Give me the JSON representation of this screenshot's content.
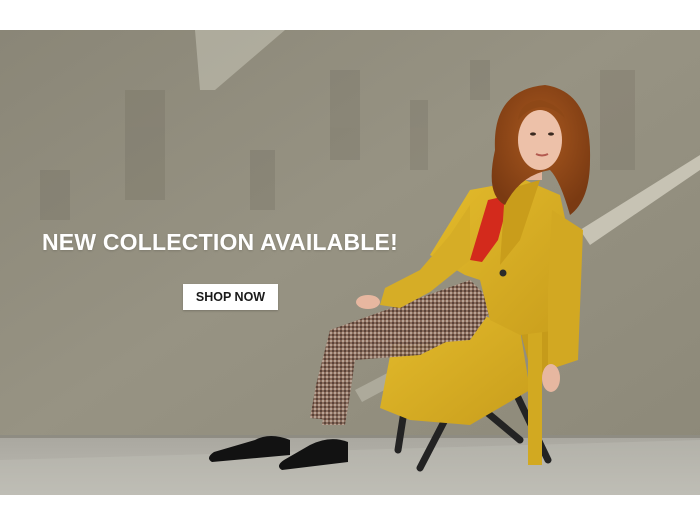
{
  "banner": {
    "headline": "NEW COLLECTION AVAILABLE!",
    "cta_label": "SHOP NOW",
    "colors": {
      "wall": "#8f8b7c",
      "floor": "#a8a69e",
      "coat": "#d9b024",
      "top": "#d62a1e",
      "button_bg": "#ffffff",
      "button_text": "#1a1a1a",
      "headline_text": "#ffffff"
    }
  }
}
